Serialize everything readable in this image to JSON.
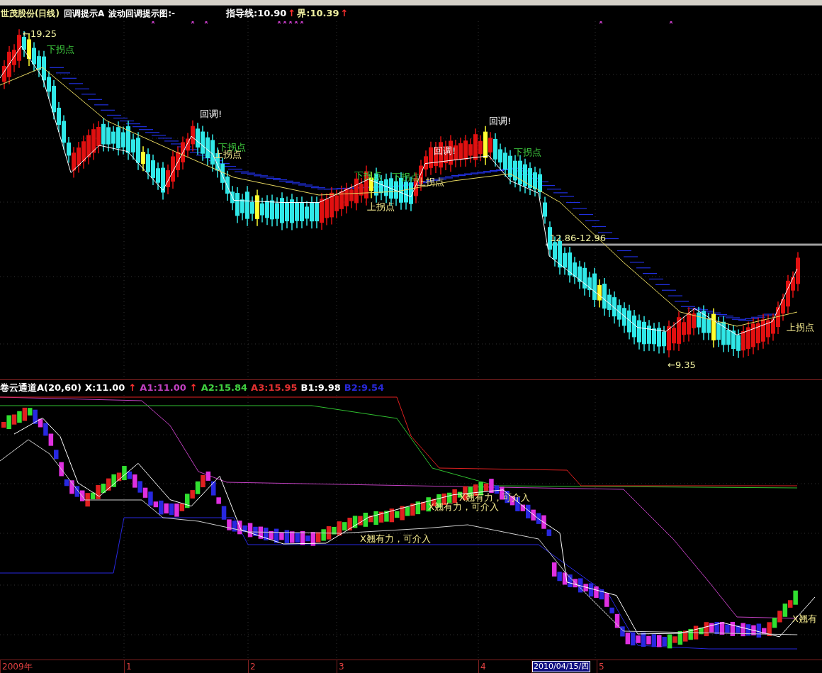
{
  "upper_panel": {
    "header_left": [
      {
        "text": "世茂股份(日线)",
        "color": "#f0f0a0"
      },
      {
        "text": "回调提示A",
        "color": "#ffffff"
      },
      {
        "text": "波动回调提示图:-",
        "color": "#ffffff"
      }
    ],
    "header_right": [
      {
        "text": "指导线:10.90",
        "color": "#ffffff"
      },
      {
        "text": "↑",
        "color": "#ff3030"
      },
      {
        "text": "界:10.39",
        "color": "#f0f0a0"
      },
      {
        "text": "↑",
        "color": "#ff3030"
      }
    ],
    "annotations": [
      {
        "text": "←19.25",
        "kind": "price"
      },
      {
        "text": "下拐点",
        "kind": "down_turn"
      },
      {
        "text": "回调!",
        "kind": "pullback"
      },
      {
        "text": "下拐点",
        "kind": "down_turn"
      },
      {
        "text": "上拐点",
        "kind": "up_turn"
      },
      {
        "text": "下拐点",
        "kind": "down_turn"
      },
      {
        "text": "下拐点",
        "kind": "down_turn"
      },
      {
        "text": "上拐点",
        "kind": "up_turn"
      },
      {
        "text": "上拐点",
        "kind": "up_turn"
      },
      {
        "text": "回调!",
        "kind": "pullback"
      },
      {
        "text": "回调!",
        "kind": "pullback"
      },
      {
        "text": "下拐点",
        "kind": "down_turn"
      },
      {
        "text": "12.86-12.96",
        "kind": "price"
      },
      {
        "text": "←9.35",
        "kind": "price"
      },
      {
        "text": "上拐点",
        "kind": "up_turn"
      }
    ]
  },
  "lower_panel": {
    "header": [
      {
        "text": "卷云通道A(20,60)",
        "color": "#ffffff"
      },
      {
        "text": "X:11.00",
        "color": "#ffffff"
      },
      {
        "text": "↑",
        "color": "#ff3030"
      },
      {
        "text": "A1:11.00",
        "color": "#c040c0"
      },
      {
        "text": "↑",
        "color": "#ff3030"
      },
      {
        "text": "A2:15.84",
        "color": "#40d040"
      },
      {
        "text": "A3:15.95",
        "color": "#e03030"
      },
      {
        "text": "B1:9.98",
        "color": "#ffffff"
      },
      {
        "text": "B2:9.54",
        "color": "#2828d8"
      }
    ],
    "annotations": [
      {
        "text": "X翘有力，可介入"
      },
      {
        "text": "X翘有力，可介入"
      },
      {
        "text": "X翘有力，可介入"
      },
      {
        "text": "X翘有"
      }
    ]
  },
  "time_axis": [
    {
      "text": "2009年",
      "kind": "tick"
    },
    {
      "text": "1",
      "kind": "tick"
    },
    {
      "text": "2",
      "kind": "tick"
    },
    {
      "text": "3",
      "kind": "tick"
    },
    {
      "text": "4",
      "kind": "tick"
    },
    {
      "text": "2010/04/15/四",
      "kind": "cursor"
    },
    {
      "text": "5",
      "kind": "tick"
    }
  ]
}
